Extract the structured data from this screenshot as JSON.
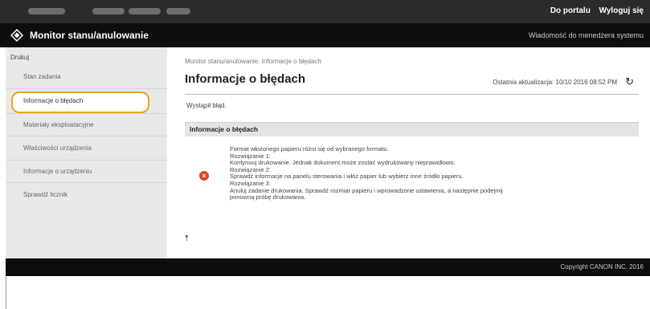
{
  "header": {
    "portal_link": "Do portalu",
    "logout_link": "Wyloguj się"
  },
  "titlebar": {
    "app_title": "Monitor stanu/anulowanie",
    "message_link": "Wiadomość do menedżera systemu"
  },
  "sidebar": {
    "section": "Drukuj",
    "items": [
      {
        "label": "Stan zadania"
      },
      {
        "label": "Informacje o błędach"
      },
      {
        "label": "Materiały eksploatacyjne"
      },
      {
        "label": "Właściwości urządzenia"
      },
      {
        "label": "Informacje o urządzeniu"
      },
      {
        "label": "Sprawdź licznik"
      }
    ]
  },
  "main": {
    "breadcrumb": "Monitor stanu/anulowanie: Informacje o błędach",
    "title": "Informacje o błędach",
    "last_updated": "Ostatnia aktualizacja: 10/10 2016 08:52 PM",
    "status_text": "Wystąpił błąd.",
    "section_title": "Informacje o błędach",
    "error_lines": [
      "Format włożonego papieru różni się od wybranego formatu.",
      "Rozwiązanie 1:",
      "Kontynuuj drukowanie. Jednak dokument może zostać wydrukowany nieprawidłowo.",
      "Rozwiązanie 2:",
      "Sprawdź informacje na panelu sterowania i włóż papier lub wybierz inne źródło papieru.",
      "Rozwiązanie 3:",
      "Anuluj zadanie drukowania. Sprawdź rozmiar papieru i wprowadzone ustawienia, a następnie podejmij",
      "ponowną próbę drukowania."
    ]
  },
  "footer": {
    "copyright": "Copyright CANON INC. 2016"
  },
  "icons": {
    "logo": "canon-diamond-logo-icon",
    "refresh": "refresh-icon",
    "error": "error-icon",
    "back_to_top": "back-to-top-icon"
  },
  "colors": {
    "highlight": "#f0a21c",
    "error": "#e0442b",
    "header_bg": "#0d0d0d"
  }
}
